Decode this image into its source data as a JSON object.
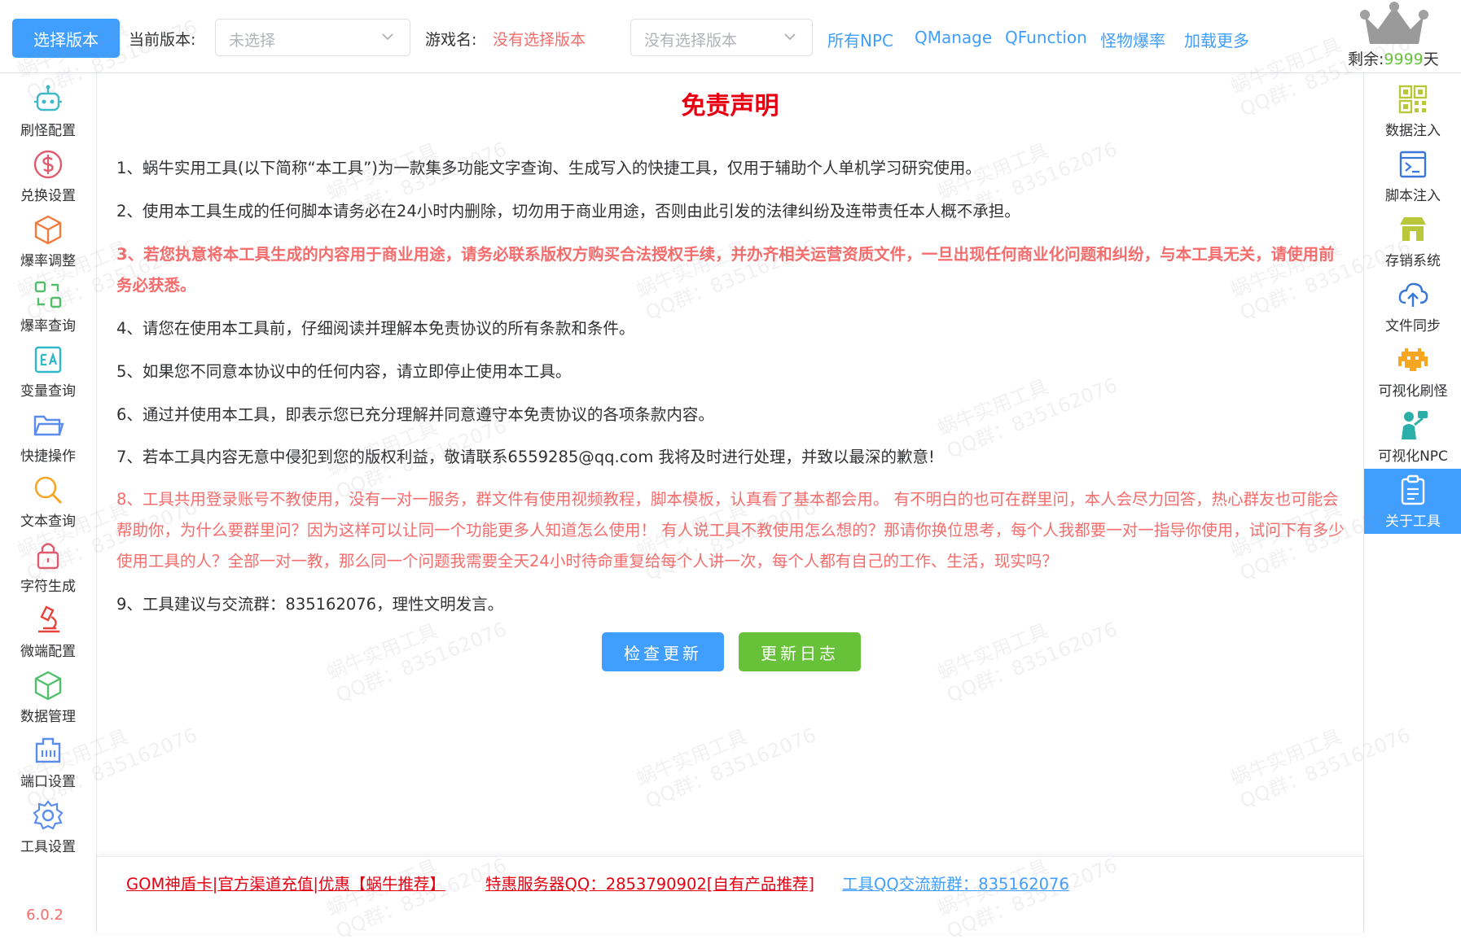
{
  "topbar": {
    "select_version_button": "选择版本",
    "current_version_label": "当前版本:",
    "version_select_placeholder": "未选择",
    "game_name_label": "游戏名:",
    "game_name_value": "没有选择版本",
    "game_select_placeholder": "没有选择版本",
    "links": [
      "所有NPC",
      "QManage",
      "QFunction",
      "怪物爆率",
      "加载更多"
    ],
    "remaining_label": "剩余:",
    "remaining_value": "9999",
    "remaining_unit": "天"
  },
  "left_sidebar": {
    "items": [
      {
        "label": "刷怪配置",
        "icon": "robot-icon"
      },
      {
        "label": "兑换设置",
        "icon": "dollar-icon"
      },
      {
        "label": "爆率调整",
        "icon": "cube-icon"
      },
      {
        "label": "爆率查询",
        "icon": "refresh-grid-icon"
      },
      {
        "label": "变量查询",
        "icon": "variable-icon"
      },
      {
        "label": "快捷操作",
        "icon": "folder-icon"
      },
      {
        "label": "文本查询",
        "icon": "magnifier-icon"
      },
      {
        "label": "字符生成",
        "icon": "lock-icon"
      },
      {
        "label": "微端配置",
        "icon": "microscope-icon"
      },
      {
        "label": "数据管理",
        "icon": "box-icon"
      },
      {
        "label": "端口设置",
        "icon": "port-icon"
      },
      {
        "label": "工具设置",
        "icon": "gear-icon"
      }
    ],
    "version": "6.0.2"
  },
  "right_sidebar": {
    "items": [
      {
        "label": "数据注入",
        "icon": "qrcode-icon"
      },
      {
        "label": "脚本注入",
        "icon": "terminal-icon"
      },
      {
        "label": "存销系统",
        "icon": "store-icon"
      },
      {
        "label": "文件同步",
        "icon": "cloud-upload-icon"
      },
      {
        "label": "可视化刷怪",
        "icon": "space-invader-icon"
      },
      {
        "label": "可视化NPC",
        "icon": "npc-icon"
      },
      {
        "label": "关于工具",
        "icon": "clipboard-icon",
        "active": true
      }
    ]
  },
  "main": {
    "title": "免责声明",
    "items": [
      "1、蜗牛实用工具(以下简称“本工具”)为一款集多功能文字查询、生成写入的快捷工具，仅用于辅助个人单机学习研究使用。",
      "2、使用本工具生成的任何脚本请务必在24小时内删除，切勿用于商业用途，否则由此引发的法律纠纷及连带责任本人概不承担。",
      "3、若您执意将本工具生成的内容用于商业用途，请务必联系版权方购买合法授权手续，并办齐相关运营资质文件，一旦出现任何商业化问题和纠纷，与本工具无关，请使用前务必获悉。",
      "4、请您在使用本工具前，仔细阅读并理解本免责协议的所有条款和条件。",
      "5、如果您不同意本协议中的任何内容，请立即停止使用本工具。",
      "6、通过并使用本工具，即表示您已充分理解并同意遵守本免责协议的各项条款内容。",
      "7、若本工具内容无意中侵犯到您的版权利益，敬请联系6559285@qq.com 我将及时进行处理，并致以最深的歉意!",
      "8、工具共用登录账号不教使用，没有一对一服务，群文件有使用视频教程，脚本模板，认真看了基本都会用。 有不明白的也可在群里问，本人会尽力回答，热心群友也可能会帮助你，为什么要群里问？因为这样可以让同一个功能更多人知道怎么使用！ 有人说工具不教使用怎么想的？那请你换位思考，每个人我都要一对一指导你使用，试问下有多少使用工具的人？全部一对一教，那么同一个问题我需要全天24小时待命重复给每个人讲一次，每个人都有自己的工作、生活，现实吗？",
      "9、工具建议与交流群：835162076，理性文明发言。"
    ],
    "check_update_button": "检查更新",
    "changelog_button": "更新日志"
  },
  "footer": {
    "links": [
      "GOM神盾卡|官方渠道充值|优惠【蜗牛推荐】",
      "特惠服务器QQ：2853790902[自有产品推荐]",
      "工具QQ交流新群：835162076"
    ]
  },
  "watermark": [
    "蜗牛实用工具",
    "QQ群：835162076"
  ],
  "colors": {
    "primary": "#409eff",
    "success": "#67c23a",
    "danger": "#f56c6c",
    "title_red": "#e60012"
  }
}
